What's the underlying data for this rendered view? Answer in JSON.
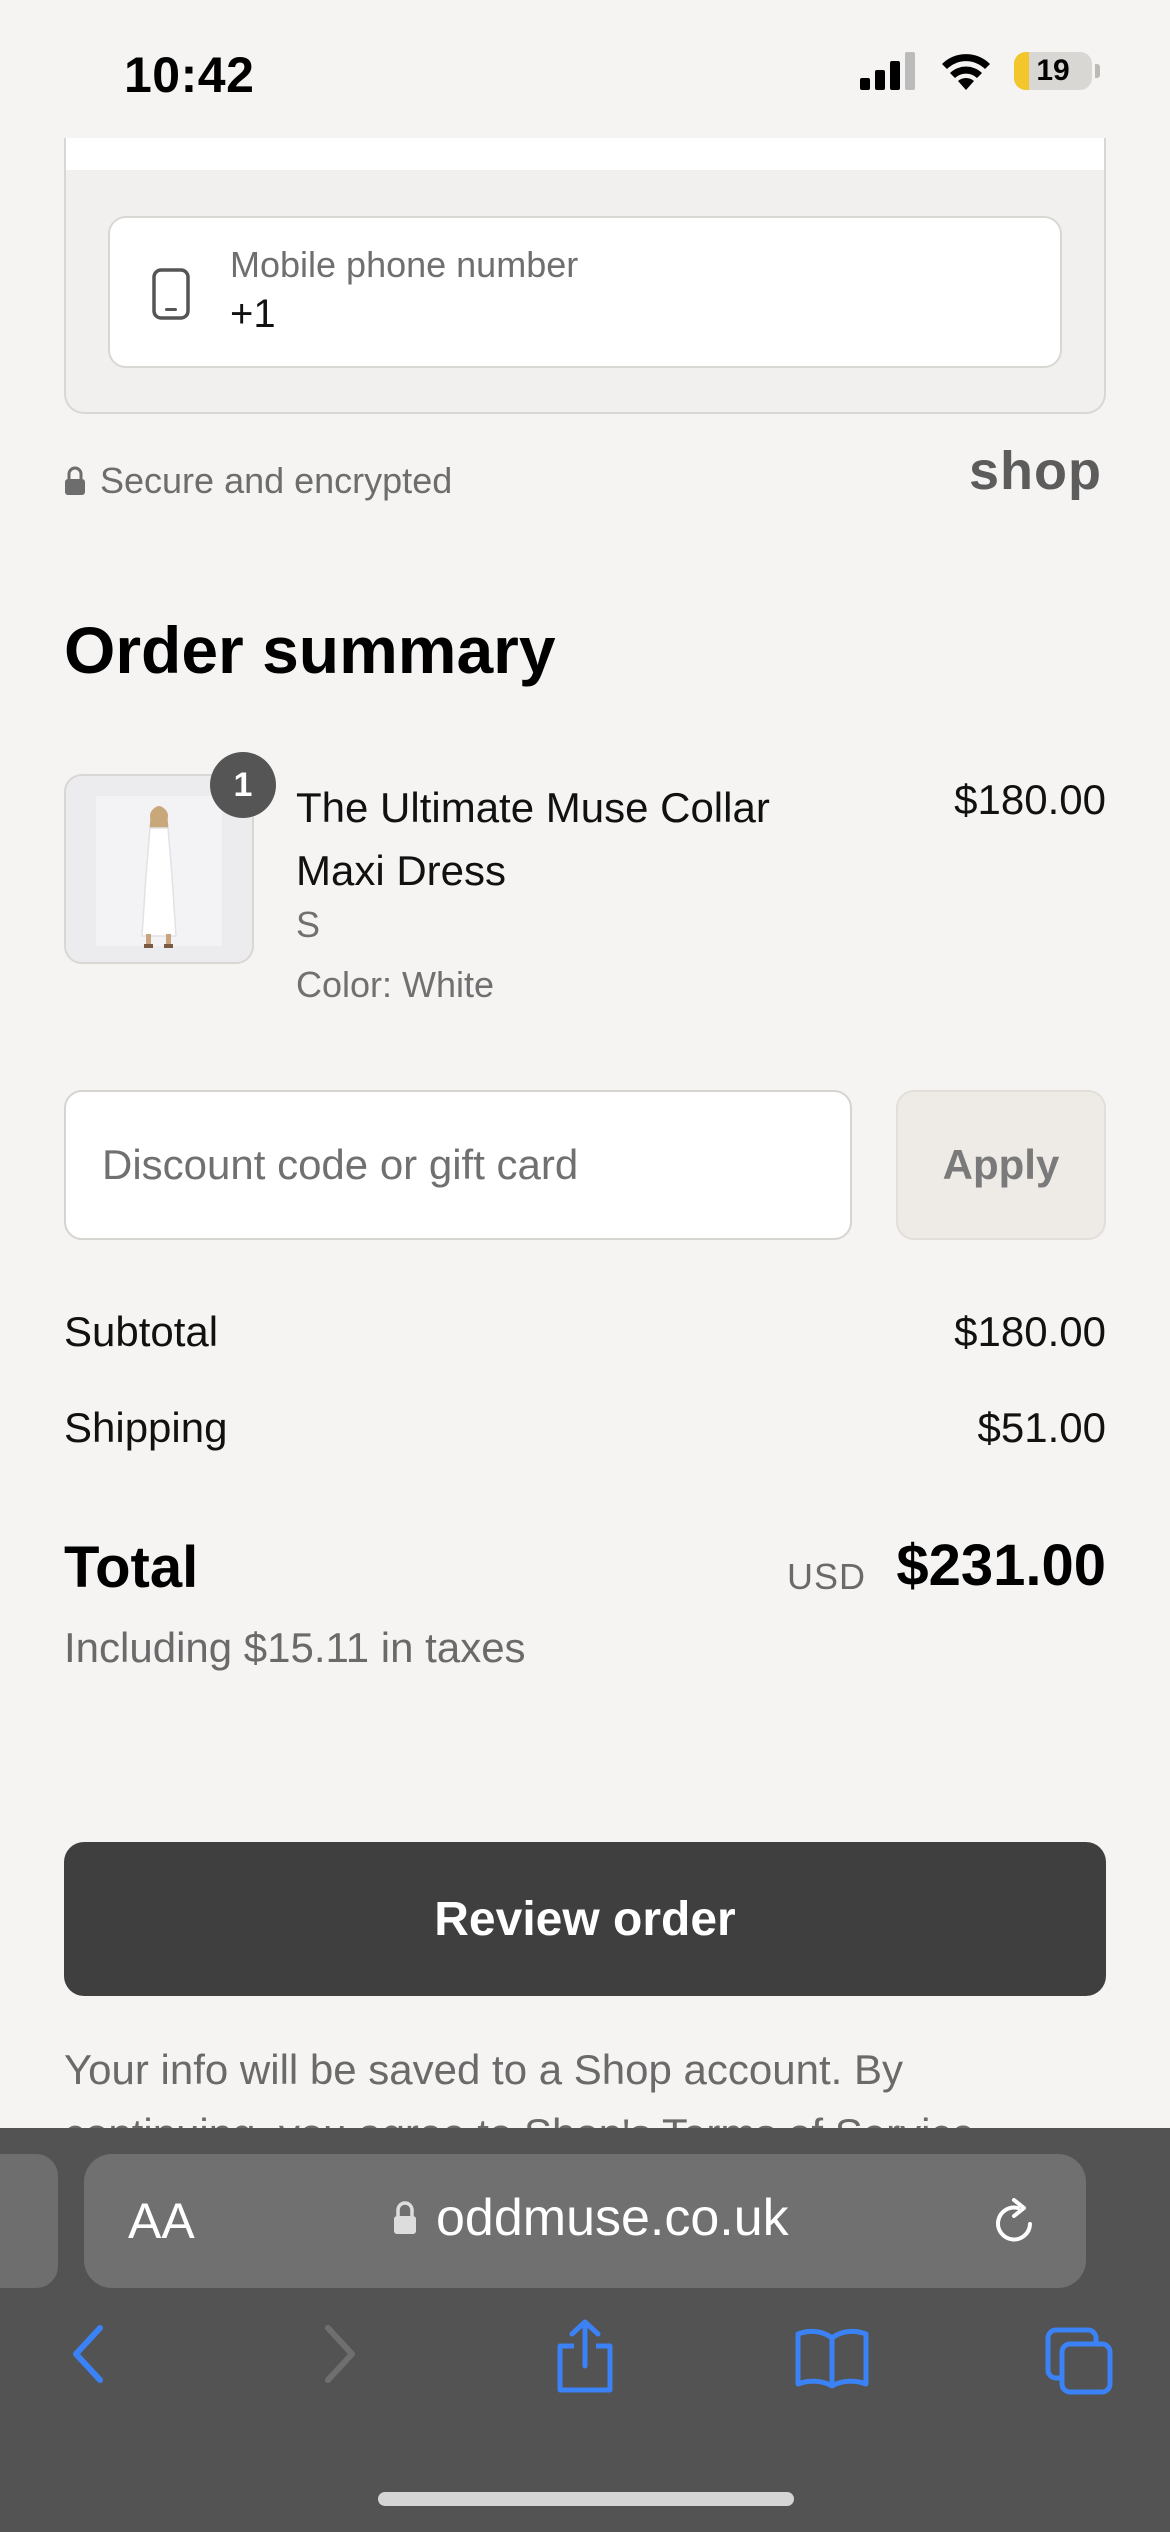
{
  "status_bar": {
    "time": "10:42",
    "battery": "19"
  },
  "phone_field": {
    "label": "Mobile phone number",
    "value": "+1"
  },
  "secure_text": "Secure and encrypted",
  "shop_logo": "shop",
  "order_summary": {
    "title": "Order summary",
    "item": {
      "quantity": "1",
      "name": "The Ultimate Muse Collar Maxi Dress",
      "price": "$180.00",
      "variant": "S",
      "color": "Color: White"
    },
    "discount": {
      "placeholder": "Discount code or gift card",
      "apply_label": "Apply"
    },
    "subtotal_label": "Subtotal",
    "subtotal_value": "$180.00",
    "shipping_label": "Shipping",
    "shipping_value": "$51.00",
    "total_label": "Total",
    "total_currency": "USD",
    "total_value": "$231.00",
    "taxes_note": "Including $15.11 in taxes"
  },
  "review_button": "Review order",
  "info_text": "Your info will be saved to a Shop account. By continuing, you agree to Shop's Terms of Service",
  "browser": {
    "aa_label": "AA",
    "url": "oddmuse.co.uk"
  },
  "colors": {
    "button": "#3f3f3f",
    "toolbar_accent": "#3b82f6",
    "background": "#f5f4f2"
  }
}
